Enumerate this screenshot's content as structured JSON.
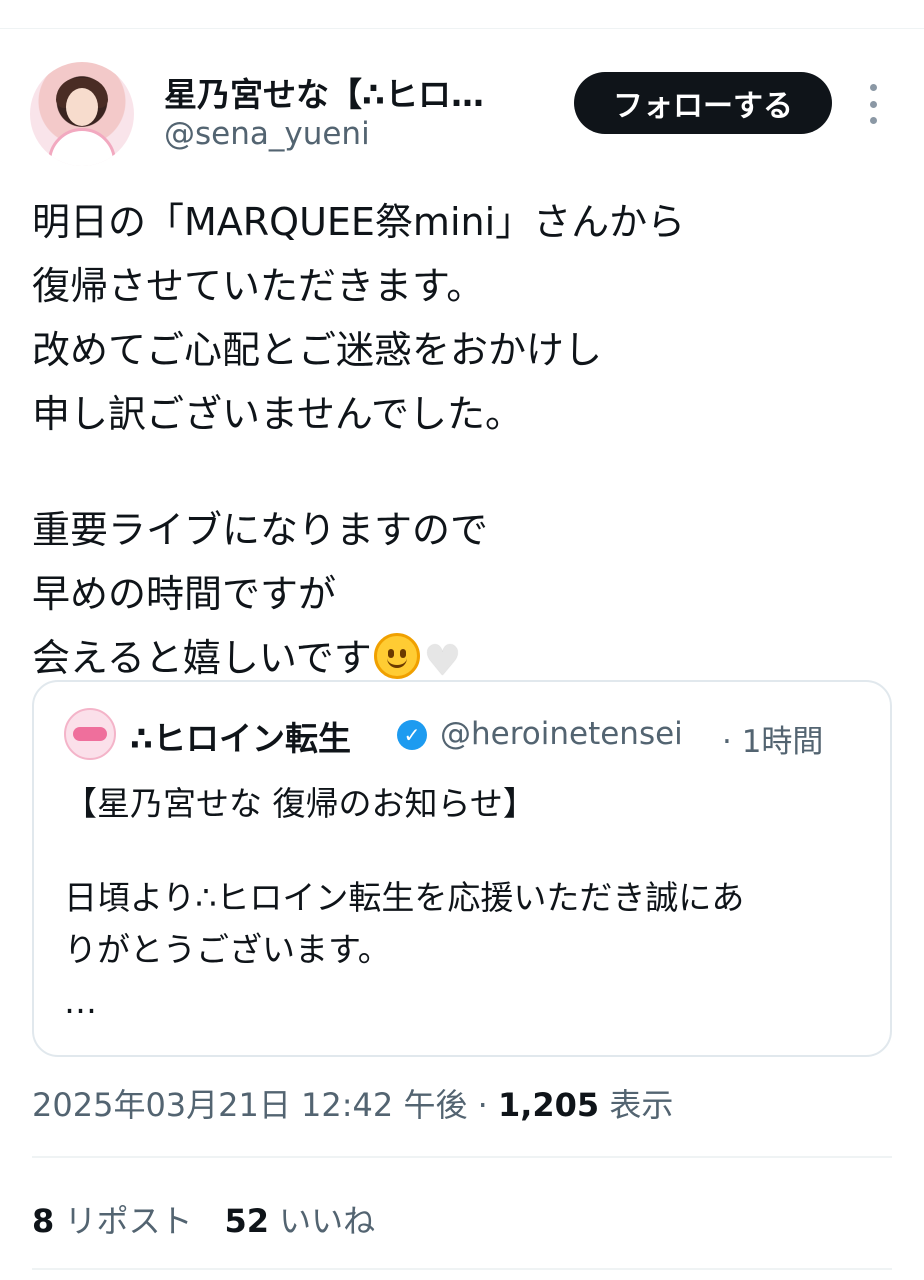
{
  "author": {
    "display_name": "星乃宮せな【∴ヒロ…",
    "handle": "@sena_yueni"
  },
  "follow_label": "フォローする",
  "tweet": {
    "lines": [
      "明日の「MARQUEE祭mini」さんから",
      "復帰させていただきます。",
      "改めてご心配とご迷惑をおかけし",
      "申し訳ございませんでした。",
      "重要ライブになりますので",
      "早めの時間ですが",
      "会えると嬉しいです"
    ],
    "emojis": [
      "smiling-face",
      "white-heart"
    ]
  },
  "quoted_tweet": {
    "display_name": "∴ヒロイン転生",
    "handle": "@heroinetensei",
    "time": "· 1時間",
    "lines": [
      "【星乃宮せな 復帰のお知らせ】",
      "日頃より∴ヒロイン転生を応援いただき誠にあ",
      "りがとうございます。",
      "…"
    ]
  },
  "meta": {
    "timestamp": "2025年03月21日 12:42 午後 · ",
    "views_count": "1,205",
    "views_label": " 表示"
  },
  "stats": {
    "reposts_count": "8",
    "reposts_label": " リポスト",
    "likes_count": "52",
    "likes_label": " いいね"
  },
  "colors": {
    "text_primary": "#0f1419",
    "text_secondary": "#536471",
    "follow_button_bg": "#0f1419",
    "verified_badge": "#1d9bf0",
    "divider": "#eff3f4"
  }
}
